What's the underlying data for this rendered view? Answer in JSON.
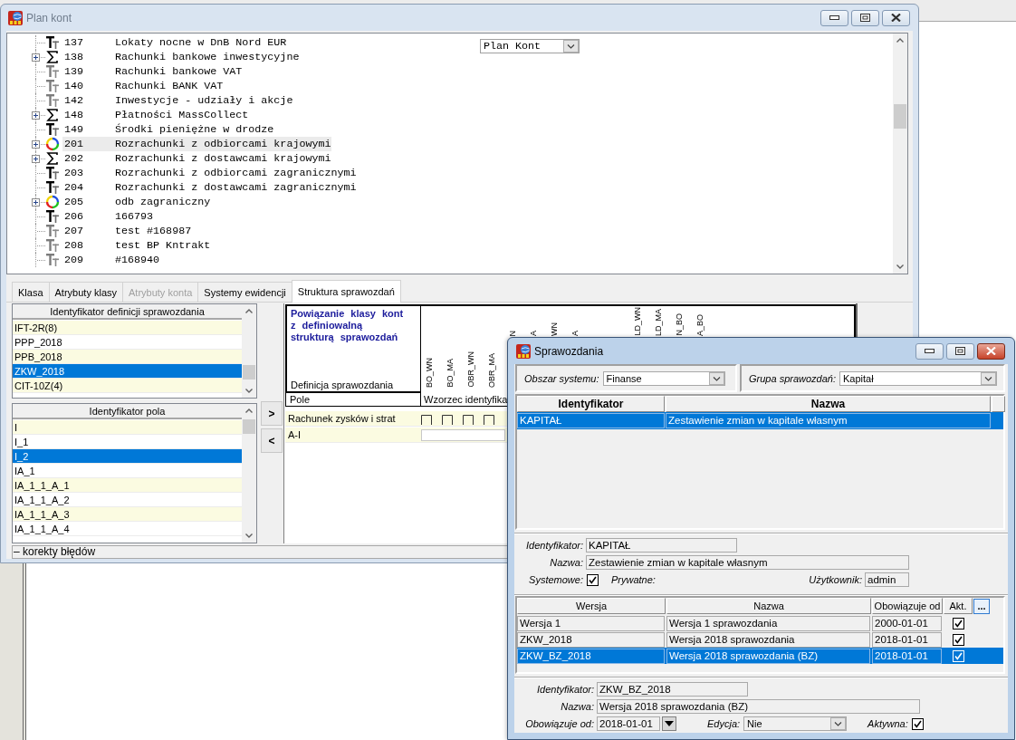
{
  "plan_kont_window": {
    "title": "Plan kont",
    "active": false,
    "tree": [
      {
        "number": "137",
        "name": "Lokaty nocne w DnB Nord EUR",
        "kind": "leaf",
        "dimmed": false,
        "expandable": false,
        "selected": false
      },
      {
        "number": "138",
        "name": "Rachunki bankowe inwestycyjne",
        "kind": "sum",
        "dimmed": false,
        "expandable": true,
        "selected": false
      },
      {
        "number": "139",
        "name": "Rachunki bankowe VAT",
        "kind": "leaf",
        "dimmed": true,
        "expandable": false,
        "selected": false
      },
      {
        "number": "140",
        "name": "Rachunki BANK VAT",
        "kind": "leaf",
        "dimmed": true,
        "expandable": false,
        "selected": false
      },
      {
        "number": "142",
        "name": "Inwestycje - udziały i akcje",
        "kind": "leaf",
        "dimmed": true,
        "expandable": false,
        "selected": false
      },
      {
        "number": "148",
        "name": "Płatności MassCollect",
        "kind": "sum",
        "dimmed": false,
        "expandable": true,
        "selected": false
      },
      {
        "number": "149",
        "name": "Środki pieniężne w drodze",
        "kind": "leaf",
        "dimmed": false,
        "expandable": false,
        "selected": false
      },
      {
        "number": "201",
        "name": "Rozrachunki z odbiorcami krajowymi",
        "kind": "ring",
        "dimmed": false,
        "expandable": true,
        "selected": true
      },
      {
        "number": "202",
        "name": "Rozrachunki z dostawcami krajowymi",
        "kind": "sum",
        "dimmed": false,
        "expandable": true,
        "selected": false
      },
      {
        "number": "203",
        "name": "Rozrachunki z odbiorcami zagranicznymi",
        "kind": "leaf",
        "dimmed": false,
        "expandable": false,
        "selected": false
      },
      {
        "number": "204",
        "name": "Rozrachunki z dostawcami zagranicznymi",
        "kind": "leaf",
        "dimmed": false,
        "expandable": false,
        "selected": false
      },
      {
        "number": "205",
        "name": "odb zagraniczny",
        "kind": "ring",
        "dimmed": false,
        "expandable": true,
        "selected": false
      },
      {
        "number": "206",
        "name": "166793",
        "kind": "leaf",
        "dimmed": false,
        "expandable": false,
        "selected": false
      },
      {
        "number": "207",
        "name": "test #168987",
        "kind": "leaf",
        "dimmed": true,
        "expandable": false,
        "selected": false
      },
      {
        "number": "208",
        "name": "test BP Kntrakt",
        "kind": "leaf",
        "dimmed": true,
        "expandable": false,
        "selected": false
      },
      {
        "number": "209",
        "name": "#168940",
        "kind": "leaf",
        "dimmed": true,
        "expandable": false,
        "selected": false
      }
    ],
    "plan_select": {
      "value": "Plan Kont"
    },
    "tabs": [
      {
        "label": "Klasa",
        "selected": false,
        "disabled": false
      },
      {
        "label": "Atrybuty klasy",
        "selected": false,
        "disabled": false
      },
      {
        "label": "Atrybuty konta",
        "selected": false,
        "disabled": true
      },
      {
        "label": "Systemy ewidencji",
        "selected": false,
        "disabled": false
      },
      {
        "label": "Struktura sprawozdań",
        "selected": true,
        "disabled": false
      }
    ],
    "report_definitions": {
      "header": "Identyfikator definicji sprawozdania",
      "rows": [
        {
          "label": "IFT-2R(8)",
          "selected": false
        },
        {
          "label": "PPP_2018",
          "selected": false
        },
        {
          "label": "PPB_2018",
          "selected": false
        },
        {
          "label": "ZKW_2018",
          "selected": true
        },
        {
          "label": "CIT-10Z(4)",
          "selected": false
        }
      ]
    },
    "fields": {
      "header": "Identyfikator pola",
      "rows": [
        {
          "label": "I",
          "selected": false
        },
        {
          "label": "I_1",
          "selected": false
        },
        {
          "label": "I_2",
          "selected": true
        },
        {
          "label": "IA_1",
          "selected": false
        },
        {
          "label": "IA_1_1_A_1",
          "selected": false
        },
        {
          "label": "IA_1_1_A_2",
          "selected": false
        },
        {
          "label": "IA_1_1_A_3",
          "selected": false
        },
        {
          "label": "IA_1_1_A_4",
          "selected": false
        }
      ]
    },
    "move_buttons": [
      ">",
      "<"
    ],
    "structure": {
      "title": "Powiązanie klasy kont z definiowalną strukturą sprawozdań",
      "definition_label": "Definicja sprawozdania",
      "field_label": "Pole",
      "columns": [
        "BO_WN",
        "BO_MA",
        "OBR_WN",
        "OBR_MA"
      ],
      "cut_columns": [
        "N",
        "A",
        "WN",
        "A",
        "LD_WN",
        "LD_MA",
        "N_BO",
        "A_BO"
      ],
      "pattern_label": "Wzorzec identyfika",
      "rows": [
        {
          "kind": "checkboxes",
          "label": "Rachunek zysków i strat",
          "checks": [
            {
              "checked": false
            },
            {
              "checked": false
            },
            {
              "checked": false
            },
            {
              "checked": false
            }
          ]
        },
        {
          "kind": "input",
          "label": "A-I"
        }
      ]
    },
    "footer": "– korekty błędów"
  },
  "sprawozdania_window": {
    "title": "Sprawozdania",
    "active": true,
    "filters": [
      {
        "label": "Obszar systemu:",
        "value": "Finanse",
        "disabled": false
      },
      {
        "label": "Grupa sprawozdań:",
        "value": "Kapitał",
        "disabled": false
      }
    ],
    "reports_table": {
      "columns": [
        "Identyfikator",
        "Nazwa"
      ],
      "rows": [
        {
          "identifier": "KAPITAŁ",
          "name": "Zestawienie zmian w kapitale własnym",
          "selected": true
        }
      ]
    },
    "report_form": {
      "identifier": {
        "label": "Identyfikator:",
        "value": "KAPITAŁ"
      },
      "name": {
        "label": "Nazwa:",
        "value": "Zestawienie zmian w kapitale własnym"
      },
      "system": {
        "label": "Systemowe:",
        "checked": true
      },
      "private": {
        "label": "Prywatne:"
      },
      "user": {
        "label": "Użytkownik:",
        "value": "admin"
      }
    },
    "versions_table": {
      "columns": [
        "Wersja",
        "Nazwa",
        "Obowiązuje od",
        "Akt."
      ],
      "more_button": "...",
      "rows": [
        {
          "version": "Wersja 1",
          "name": "Wersja 1 sprawozdania",
          "valid_from": "2000-01-01",
          "active": true,
          "selected": false
        },
        {
          "version": "ZKW_2018",
          "name": "Wersja 2018 sprawozdania",
          "valid_from": "2018-01-01",
          "active": true,
          "selected": false
        },
        {
          "version": "ZKW_BZ_2018",
          "name": "Wersja 2018 sprawozdania (BZ)",
          "valid_from": "2018-01-01",
          "active": true,
          "selected": true
        }
      ]
    },
    "version_form": {
      "identifier": {
        "label": "Identyfikator:",
        "value": "ZKW_BZ_2018"
      },
      "name": {
        "label": "Nazwa:",
        "value": "Wersja 2018 sprawozdania (BZ)"
      },
      "valid_from": {
        "label": "Obowiązuje od:",
        "value": "2018-01-01"
      },
      "edit": {
        "label": "Edycja:",
        "value": "Nie",
        "disabled": true
      },
      "active": {
        "label": "Aktywna:",
        "checked": true
      }
    }
  }
}
